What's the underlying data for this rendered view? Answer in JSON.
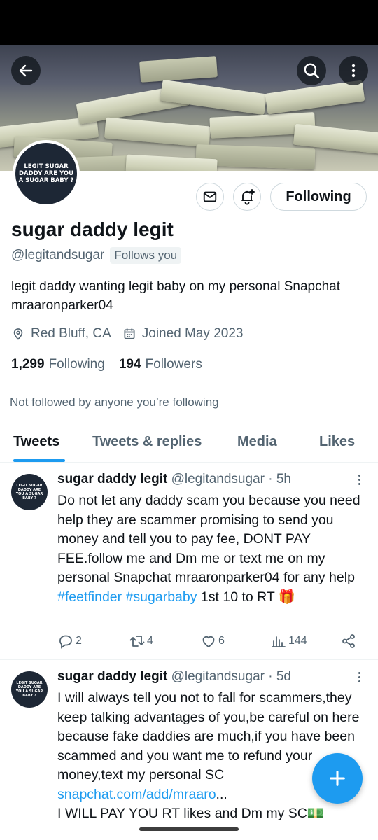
{
  "profile": {
    "name": "sugar daddy legit",
    "handle": "@legitandsugar",
    "follows_you": "Follows you",
    "avatar_text": "LEGIT SUGAR DADDY ARE YOU A SUGAR BABY ?",
    "bio": "legit daddy wanting legit baby on my personal Snapchat mraaronparker04",
    "location": "Red Bluff, CA",
    "joined": "Joined May 2023",
    "following_count": "1,299",
    "following_label": "Following",
    "followers_count": "194",
    "followers_label": "Followers",
    "not_followed": "Not followed by anyone you’re following"
  },
  "header": {
    "back_icon": "arrow-left-icon",
    "search_icon": "search-icon",
    "more_icon": "more-vertical-icon"
  },
  "actions_bar": {
    "message_icon": "mail-icon",
    "notify_icon": "bell-plus-icon",
    "following_button": "Following"
  },
  "tabs": [
    {
      "label": "Tweets",
      "active": true
    },
    {
      "label": "Tweets & replies",
      "active": false
    },
    {
      "label": "Media",
      "active": false
    },
    {
      "label": "Likes",
      "active": false
    }
  ],
  "tweets": [
    {
      "name": "sugar daddy legit",
      "handle_time": "@legitandsugar · 5h",
      "text_plain_1": "Do not let any daddy scam you because you need help they are scammer promising to send you money and tell you to pay fee, DONT PAY FEE.follow me and Dm me or text me on my personal Snapchat mraaronparker04 for any help ",
      "hashtag_1": "#feetfinder",
      "hashtag_2": "#sugarbaby",
      "text_plain_2": " 1st 10 to RT ",
      "emoji": "🎁",
      "replies": "2",
      "retweets": "4",
      "likes": "6",
      "views": "144"
    },
    {
      "name": "sugar daddy legit",
      "handle_time": "@legitandsugar · 5d",
      "text_plain_1": "I will always tell you not to fall for scammers,they keep talking advantages of you,be careful on here because fake daddies are much,if you have been scammed and you want me to refund your money,text my personal SC ",
      "link": "snapchat.com/add/mraaro",
      "ellipsis": "...",
      "text_plain_2": "\nI WILL PAY YOU RT likes and Dm my SC",
      "emoji": "💵"
    }
  ],
  "fab": {
    "icon": "plus-icon"
  },
  "colors": {
    "accent": "#1d9bf0",
    "text": "#0f1419",
    "secondary": "#536471"
  }
}
